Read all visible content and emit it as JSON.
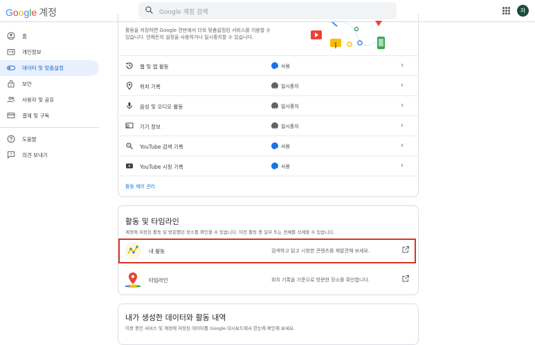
{
  "header": {
    "logo_parts": [
      "G",
      "o",
      "o",
      "g",
      "l",
      "e"
    ],
    "account_label": "계정",
    "search_placeholder": "Google 계정 검색",
    "avatar_initial": "자"
  },
  "sidebar": {
    "items": [
      {
        "label": "홈",
        "icon": "home-icon"
      },
      {
        "label": "개인정보",
        "icon": "id-card-icon"
      },
      {
        "label": "데이터 및 맞춤설정",
        "icon": "toggle-icon",
        "active": true
      },
      {
        "label": "보안",
        "icon": "lock-icon"
      },
      {
        "label": "사용자 및 공유",
        "icon": "people-icon"
      },
      {
        "label": "결제 및 구독",
        "icon": "card-icon"
      }
    ],
    "secondary": [
      {
        "label": "도움말",
        "icon": "help-icon"
      },
      {
        "label": "의견 보내기",
        "icon": "feedback-icon"
      }
    ]
  },
  "activity_controls": {
    "intro_line1": "활동을 저장하면 Google 전반에서 더욱 맞춤설정된 서비스를 이용할 수",
    "intro_line2": "있습니다. 언제든지 설정을 사용하거나 일시중지할 수 있습니다.",
    "rows": [
      {
        "name": "웹 및 앱 활동",
        "status": "사용",
        "state": "on",
        "icon": "history-icon"
      },
      {
        "name": "위치 기록",
        "status": "일시중지",
        "state": "paused",
        "icon": "location-pin-icon"
      },
      {
        "name": "음성 및 오디오 활동",
        "status": "일시중지",
        "state": "paused",
        "icon": "microphone-icon"
      },
      {
        "name": "기기 정보",
        "status": "일시중지",
        "state": "paused",
        "icon": "device-info-icon"
      },
      {
        "name": "YouTube 검색 기록",
        "status": "사용",
        "state": "on",
        "icon": "search-history-icon"
      },
      {
        "name": "YouTube 시청 기록",
        "status": "사용",
        "state": "on",
        "icon": "youtube-icon"
      }
    ],
    "manage_link": "활동 제어 관리"
  },
  "activity_timeline": {
    "title": "활동 및 타임라인",
    "description": "계정에 저장된 활동 및 방문했던 장소를 확인할 수 있습니다. 이전 활동 중 일부 또는 전체를 삭제할 수 있습니다.",
    "items": [
      {
        "name": "내 활동",
        "desc": "검색하고 읽고 시청한 콘텐츠를 재발견해 보세요."
      },
      {
        "name": "타임라인",
        "desc": "위치 기록을 기준으로 방문한 장소를 확인합니다."
      }
    ]
  },
  "your_data": {
    "title": "내가 생성한 데이터와 활동 내역",
    "description": "이용 중인 서비스 및 계정에 저장된 데이터를 Google 대시보드에서 한눈에 확인해 보세요."
  },
  "colors": {
    "accent": "#1a73e8",
    "highlight": "#d93025",
    "active_bg": "#e8f0fe"
  }
}
